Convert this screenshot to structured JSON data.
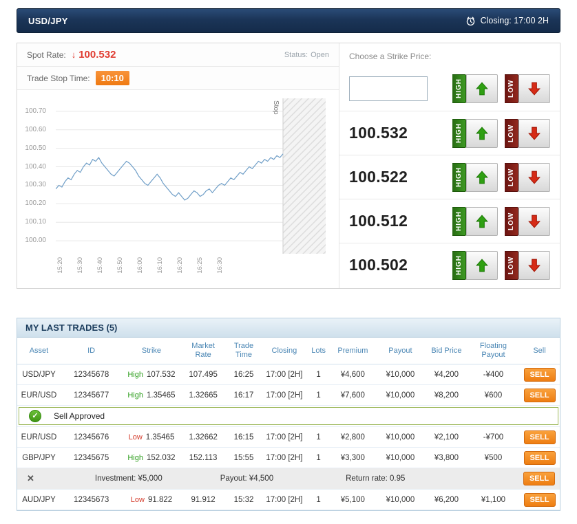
{
  "icons": {
    "down_arrow": "↓",
    "check": "✓",
    "close": "✕"
  },
  "colors": {
    "header_bg": "#1b3558",
    "spot_red": "#e03c31",
    "badge_orange": "#ef7a12",
    "high_green": "#2f7d1a",
    "low_red": "#7c1d16",
    "sell_orange": "#ee7d12",
    "table_header_blue": "#4a86b4",
    "chart_line": "#6f9ec7"
  },
  "header": {
    "pair": "USD/JPY",
    "closing": "Closing: 17:00 2H"
  },
  "market": {
    "spot_label": "Spot Rate:",
    "spot_value": "100.532",
    "status_label": "Status:",
    "status_value": "Open",
    "stop_time_label": "Trade Stop Time:",
    "stop_time_value": "10:10"
  },
  "chart_data": {
    "type": "line",
    "title": "",
    "xlabel": "",
    "ylabel": "",
    "y_ticks": [
      "100.70",
      "100.60",
      "100.50",
      "100.40",
      "100.30",
      "100.20",
      "100.10",
      "100.00"
    ],
    "x_ticks": [
      "15:20",
      "15:30",
      "15:40",
      "15:50",
      "16:00",
      "16:10",
      "16:20",
      "16:25",
      "16:30"
    ],
    "ylim": [
      99.93,
      100.77
    ],
    "grid": "horizontal",
    "stop_label": "Stop",
    "line_color": "#6f9ec7",
    "series": [
      {
        "name": "USD/JPY spot",
        "values": [
          100.28,
          100.3,
          100.29,
          100.32,
          100.34,
          100.33,
          100.36,
          100.38,
          100.37,
          100.4,
          100.42,
          100.41,
          100.44,
          100.43,
          100.45,
          100.42,
          100.4,
          100.38,
          100.36,
          100.35,
          100.37,
          100.39,
          100.41,
          100.43,
          100.42,
          100.4,
          100.38,
          100.35,
          100.33,
          100.31,
          100.3,
          100.32,
          100.34,
          100.36,
          100.34,
          100.31,
          100.29,
          100.27,
          100.25,
          100.24,
          100.26,
          100.24,
          100.22,
          100.23,
          100.25,
          100.27,
          100.26,
          100.24,
          100.25,
          100.27,
          100.28,
          100.26,
          100.28,
          100.3,
          100.31,
          100.3,
          100.32,
          100.34,
          100.33,
          100.35,
          100.37,
          100.36,
          100.38,
          100.4,
          100.39,
          100.41,
          100.43,
          100.42,
          100.44,
          100.43,
          100.45,
          100.44,
          100.46,
          100.45,
          100.47
        ]
      }
    ]
  },
  "strike_panel": {
    "title": "Choose a Strike Price:",
    "high_label": "HIGH",
    "low_label": "LOW",
    "custom_input_value": "",
    "prices": [
      "100.532",
      "100.522",
      "100.512",
      "100.502"
    ]
  },
  "trades": {
    "title": "MY LAST TRADES (5)",
    "columns": [
      "Asset",
      "ID",
      "Strike",
      "Market Rate",
      "Trade Time",
      "Closing",
      "Lots",
      "Premium",
      "Payout",
      "Bid Price",
      "Floating Payout",
      "Sell"
    ],
    "sell_label": "SELL",
    "rows": [
      {
        "asset": "USD/JPY",
        "id": "12345678",
        "direction": "High",
        "strike": "107.532",
        "market_rate": "107.495",
        "trade_time": "16:25",
        "closing": "17:00 [2H]",
        "lots": "1",
        "premium": "¥4,600",
        "payout": "¥10,000",
        "bid_price": "¥4,200",
        "floating_payout": "-¥400"
      },
      {
        "asset": "EUR/USD",
        "id": "12345677",
        "direction": "High",
        "strike": "1.35465",
        "market_rate": "1.32665",
        "trade_time": "16:17",
        "closing": "17:00 [2H]",
        "lots": "1",
        "premium": "¥7,600",
        "payout": "¥10,000",
        "bid_price": "¥8,200",
        "floating_payout": "¥600"
      },
      {
        "asset": "EUR/USD",
        "id": "12345676",
        "direction": "Low",
        "strike": "1.35465",
        "market_rate": "1.32662",
        "trade_time": "16:15",
        "closing": "17:00 [2H]",
        "lots": "1",
        "premium": "¥2,800",
        "payout": "¥10,000",
        "bid_price": "¥2,100",
        "floating_payout": "-¥700"
      },
      {
        "asset": "GBP/JPY",
        "id": "12345675",
        "direction": "High",
        "strike": "152.032",
        "market_rate": "152.113",
        "trade_time": "15:55",
        "closing": "17:00 [2H]",
        "lots": "1",
        "premium": "¥3,300",
        "payout": "¥10,000",
        "bid_price": "¥3,800",
        "floating_payout": "¥500"
      },
      {
        "asset": "AUD/JPY",
        "id": "12345673",
        "direction": "Low",
        "strike": "91.822",
        "market_rate": "91.912",
        "trade_time": "15:32",
        "closing": "17:00 [2H]",
        "lots": "1",
        "premium": "¥5,100",
        "payout": "¥10,000",
        "bid_price": "¥6,200",
        "floating_payout": "¥1,100"
      }
    ],
    "approved_message": "Sell Approved",
    "detail_row": {
      "investment": "Investment: ¥5,000",
      "payout": "Payout: ¥4,500",
      "return_rate": "Return rate: 0.95"
    }
  }
}
